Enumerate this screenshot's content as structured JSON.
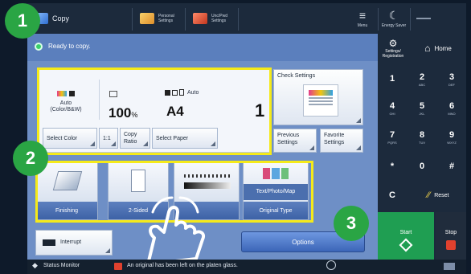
{
  "topbar": {
    "app_title": "Copy",
    "personal_settings": [
      "Personal",
      "Settings"
    ],
    "unc_settings": [
      "Unc/Pwd",
      "Settings"
    ],
    "menu_label": "Menu",
    "energy_saver_label": "Energy Saver"
  },
  "status": {
    "ready_text": "Ready to copy."
  },
  "settings_card": {
    "color_mode": [
      "Auto",
      "(Color/B&W)"
    ],
    "zoom_value": "100",
    "zoom_unit": "%",
    "paper_auto": "Auto",
    "paper_size": "A4",
    "copies": "1",
    "select_color_label": "Select Color",
    "one_to_one_label": "1:1",
    "copy_ratio_label": [
      "Copy",
      "Ratio"
    ],
    "select_paper_label": "Select Paper"
  },
  "check_settings_label": "Check Settings",
  "previous_settings_label": [
    "Previous",
    "Settings"
  ],
  "favorite_settings_label": [
    "Favorite",
    "Settings"
  ],
  "features": {
    "finishing_label": "Finishing",
    "two_sided_label": "2-Sided",
    "original_label": "Text/Photo/Map",
    "original_type_label": "Original Type"
  },
  "interrupt_label": "Interrupt",
  "options_label": "Options",
  "right_panel": {
    "settings_registration": [
      "Settings/",
      "Registration"
    ],
    "home_label": "Home",
    "keys": [
      {
        "n": "1",
        "s": ""
      },
      {
        "n": "2",
        "s": "ABC"
      },
      {
        "n": "3",
        "s": "DEF"
      },
      {
        "n": "4",
        "s": "GHI"
      },
      {
        "n": "5",
        "s": "JKL"
      },
      {
        "n": "6",
        "s": "MNO"
      },
      {
        "n": "7",
        "s": "PQRS"
      },
      {
        "n": "8",
        "s": "TUV"
      },
      {
        "n": "9",
        "s": "WXYZ"
      },
      {
        "n": "*",
        "s": ""
      },
      {
        "n": "0",
        "s": ""
      },
      {
        "n": "#",
        "s": ""
      }
    ],
    "clear_label": "C",
    "reset_label": "Reset",
    "start_label": "Start",
    "stop_label": "Stop"
  },
  "bottombar": {
    "status_monitor_label": "Status Monitor",
    "message": "An original has been left on the platen glass."
  },
  "callouts": [
    "1",
    "2",
    "3"
  ],
  "colors": {
    "yellow_highlight": "#f5ea19",
    "callout_green": "#2aa544",
    "start_green": "#1f9e52",
    "stop_red": "#e0412e"
  }
}
